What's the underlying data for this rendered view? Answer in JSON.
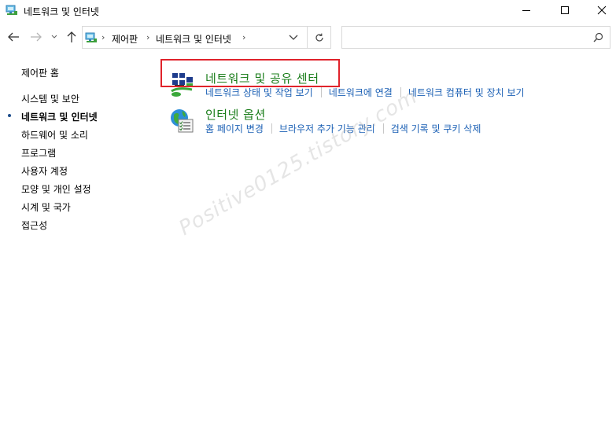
{
  "window": {
    "title": "네트워크 및 인터넷"
  },
  "navigation": {
    "breadcrumbs": [
      "제어판",
      "네트워크 및 인터넷"
    ],
    "search_placeholder": ""
  },
  "sidebar": {
    "items": [
      {
        "label": "제어판 홈",
        "active": false
      },
      {
        "label": "시스템 및 보안",
        "active": false
      },
      {
        "label": "네트워크 및 인터넷",
        "active": true
      },
      {
        "label": "하드웨어 및 소리",
        "active": false
      },
      {
        "label": "프로그램",
        "active": false
      },
      {
        "label": "사용자 계정",
        "active": false
      },
      {
        "label": "모양 및 개인 설정",
        "active": false
      },
      {
        "label": "시계 및 국가",
        "active": false
      },
      {
        "label": "접근성",
        "active": false
      }
    ]
  },
  "categories": [
    {
      "title": "네트워크 및 공유 센터",
      "icon": "network-sharing-center-icon",
      "links": [
        "네트워크 상태 및 작업 보기",
        "네트워크에 연결",
        "네트워크 컴퓨터 및 장치 보기"
      ]
    },
    {
      "title": "인터넷 옵션",
      "icon": "internet-options-icon",
      "links": [
        "홈 페이지 변경",
        "브라우저 추가 기능 관리",
        "검색 기록 및 쿠키 삭제"
      ]
    }
  ],
  "watermark": "Positive0125.tistory.com",
  "colors": {
    "link": "#1a5fb4",
    "category_title": "#1a7d1a",
    "highlight": "#e0232b"
  }
}
